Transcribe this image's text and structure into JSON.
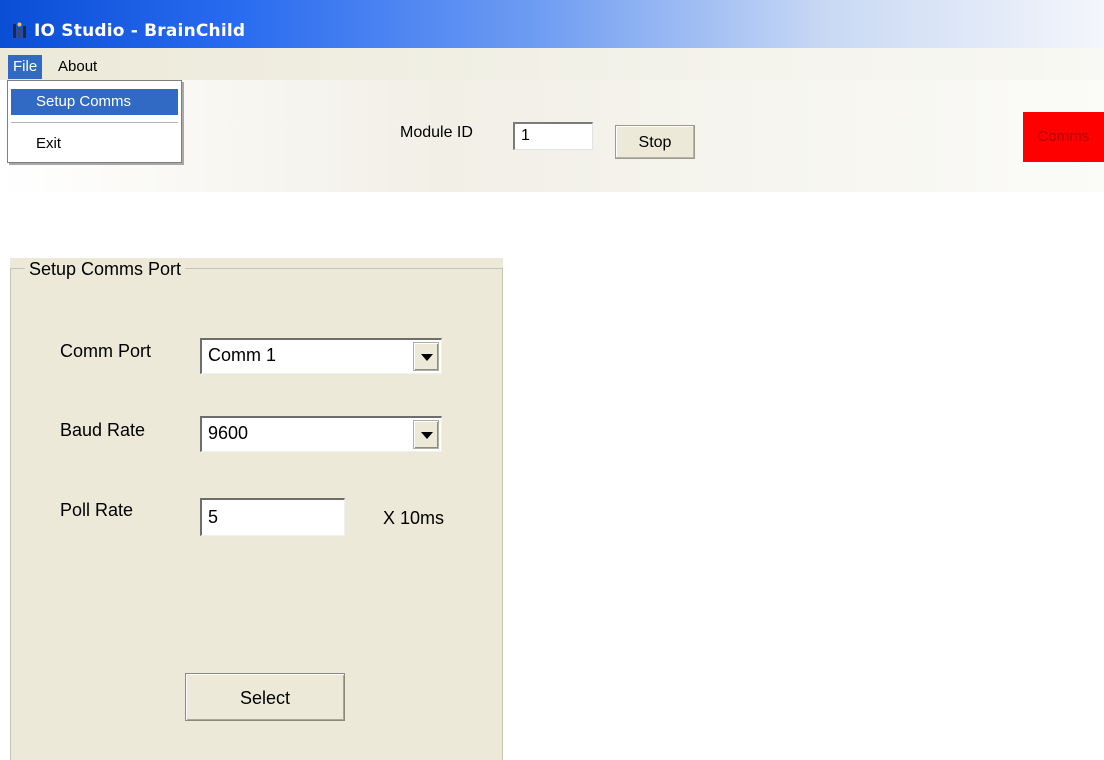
{
  "window": {
    "title": "IO Studio - BrainChild",
    "icon": "app-icon"
  },
  "menubar": {
    "items": [
      "File",
      "About"
    ]
  },
  "file_menu": {
    "items": [
      "Setup Comms",
      "Exit"
    ]
  },
  "toolbar": {
    "module_id_label": "Module ID",
    "module_id_value": "1",
    "stop_label": "Stop",
    "comms_label": "Comms",
    "comms_color": "#ff0000"
  },
  "setup_panel": {
    "title": "Setup Comms Port",
    "comm_port_label": "Comm Port",
    "comm_port_value": "Comm 1",
    "baud_rate_label": "Baud Rate",
    "baud_rate_value": "9600",
    "poll_rate_label": "Poll Rate",
    "poll_rate_value": "5",
    "poll_rate_unit": "X 10ms",
    "select_label": "Select"
  },
  "colors": {
    "menu_highlight": "#316ac5",
    "panel_bg": "#ece9d8"
  }
}
